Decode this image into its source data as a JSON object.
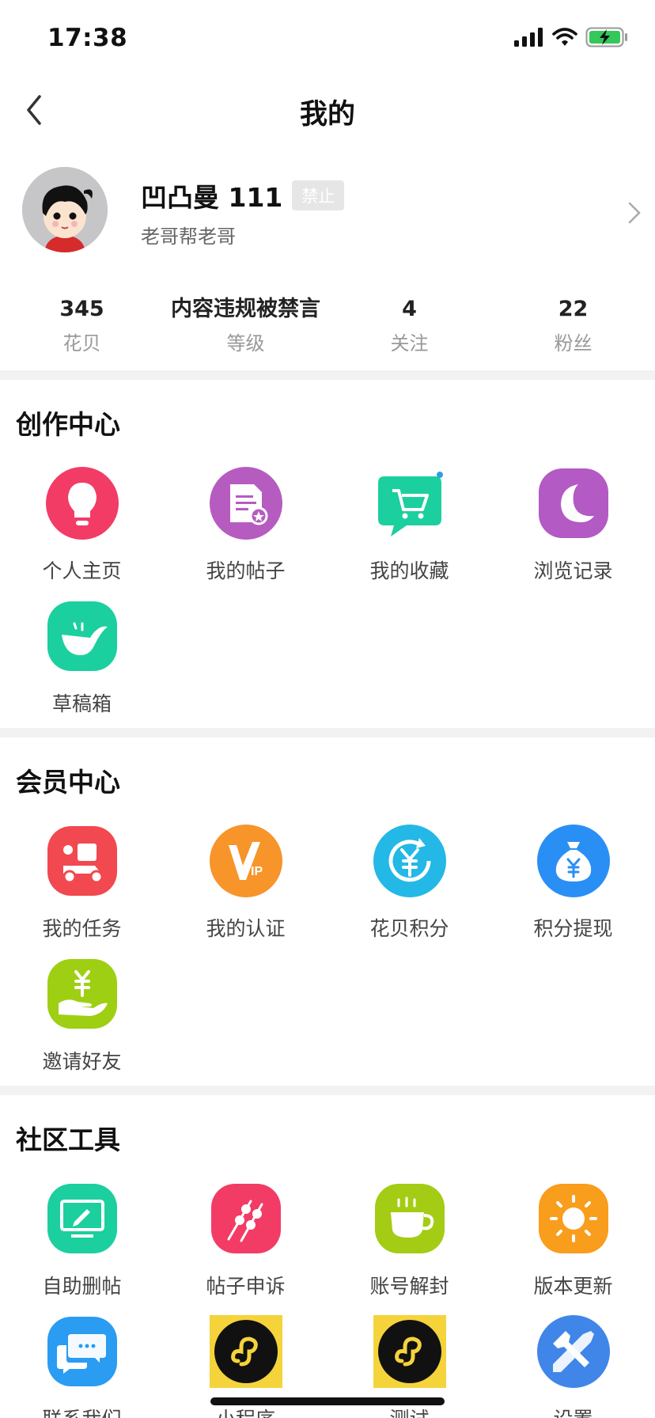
{
  "status": {
    "time": "17:38"
  },
  "nav": {
    "title": "我的"
  },
  "profile": {
    "name": "凹凸曼 111",
    "badge": "禁止",
    "subtitle": "老哥帮老哥"
  },
  "stats": [
    {
      "value": "345",
      "label": "花贝"
    },
    {
      "value": "内容违规被禁言",
      "label": "等级"
    },
    {
      "value": "4",
      "label": "关注"
    },
    {
      "value": "22",
      "label": "粉丝"
    }
  ],
  "creation": {
    "title": "创作中心",
    "items": [
      {
        "label": "个人主页",
        "icon": "lightbulb-icon",
        "color": "#f23c66"
      },
      {
        "label": "我的帖子",
        "icon": "document-icon",
        "color": "#b65cc0"
      },
      {
        "label": "我的收藏",
        "icon": "shopping-cart-icon",
        "color": "#1ccf9e"
      },
      {
        "label": "浏览记录",
        "icon": "moon-icon",
        "color": "#b35ac4"
      },
      {
        "label": "草稿箱",
        "icon": "smile-pot-icon",
        "color": "#1ccf9e"
      }
    ]
  },
  "member": {
    "title": "会员中心",
    "items": [
      {
        "label": "我的任务",
        "icon": "delivery-scooter-icon",
        "color": "#f2484f"
      },
      {
        "label": "我的认证",
        "icon": "vip-icon",
        "color": "#f7942a"
      },
      {
        "label": "花贝积分",
        "icon": "yuan-exchange-icon",
        "color": "#23b8e6"
      },
      {
        "label": "积分提现",
        "icon": "money-bag-icon",
        "color": "#2a8ff5"
      },
      {
        "label": "邀请好友",
        "icon": "yuan-hand-icon",
        "color": "#9ecf13"
      }
    ]
  },
  "tools": {
    "title": "社区工具",
    "items": [
      {
        "label": "自助删帖",
        "icon": "monitor-edit-icon",
        "color": "#1ccf9e"
      },
      {
        "label": "帖子申诉",
        "icon": "skewers-icon",
        "color": "#f23c66"
      },
      {
        "label": "账号解封",
        "icon": "coffee-cup-icon",
        "color": "#a4cc14"
      },
      {
        "label": "版本更新",
        "icon": "sun-icon",
        "color": "#f99d1c"
      },
      {
        "label": "联系我们",
        "icon": "chat-bubbles-icon",
        "color": "#2a9cf2"
      },
      {
        "label": "小程序",
        "icon": "mini-program-icon",
        "color": "#f5d33b"
      },
      {
        "label": "测试",
        "icon": "mini-program-icon",
        "color": "#f5d33b"
      },
      {
        "label": "设置",
        "icon": "wrench-screwdriver-icon",
        "color": "#3f86e8"
      }
    ]
  }
}
